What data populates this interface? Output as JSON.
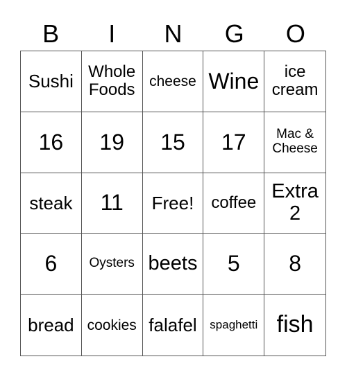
{
  "header": [
    "B",
    "I",
    "N",
    "G",
    "O"
  ],
  "cells": [
    {
      "text": "Sushi",
      "size": "s26"
    },
    {
      "text": "Whole Foods",
      "size": "s24"
    },
    {
      "text": "cheese",
      "size": "s21"
    },
    {
      "text": "Wine",
      "size": "s32"
    },
    {
      "text": "ice cream",
      "size": "s24"
    },
    {
      "text": "16",
      "size": "s32"
    },
    {
      "text": "19",
      "size": "s32"
    },
    {
      "text": "15",
      "size": "s32"
    },
    {
      "text": "17",
      "size": "s32"
    },
    {
      "text": "Mac & Cheese",
      "size": "s19"
    },
    {
      "text": "steak",
      "size": "s26"
    },
    {
      "text": "11",
      "size": "s32"
    },
    {
      "text": "Free!",
      "size": "s26"
    },
    {
      "text": "coffee",
      "size": "s24"
    },
    {
      "text": "Extra 2",
      "size": "s29"
    },
    {
      "text": "6",
      "size": "s32"
    },
    {
      "text": "Oysters",
      "size": "s19"
    },
    {
      "text": "beets",
      "size": "s29"
    },
    {
      "text": "5",
      "size": "s32"
    },
    {
      "text": "8",
      "size": "s32"
    },
    {
      "text": "bread",
      "size": "s26"
    },
    {
      "text": "cookies",
      "size": "s21"
    },
    {
      "text": "falafel",
      "size": "s26"
    },
    {
      "text": "spaghetti",
      "size": "s17"
    },
    {
      "text": "fish",
      "size": "s36"
    }
  ]
}
